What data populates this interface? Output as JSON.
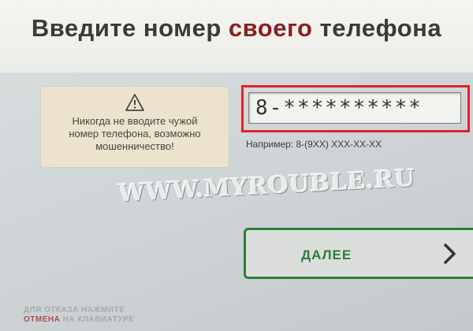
{
  "header": {
    "title_part1": "Введите номер",
    "title_accent": "своего",
    "title_part2": "телефона"
  },
  "warning": {
    "icon": "warning-triangle-icon",
    "text": "Никогда не вводите чужой номер телефона, возможно мошенничество!"
  },
  "phone_field": {
    "value": "8-**********"
  },
  "hint": {
    "text": "Например: 8-(9XX) XXX-XX-XX"
  },
  "watermark": {
    "text": "WWW.MYROUBLE.RU"
  },
  "next_button": {
    "label": "ДАЛЕЕ",
    "icon": "chevron-right-icon"
  },
  "cancel_hint": {
    "line1": "ДЛЯ ОТКАЗА НАЖМИТЕ",
    "cancel_word": "ОТМЕНА",
    "line2_rest": "НА КЛАВИАТУРЕ"
  },
  "colors": {
    "accent_red": "#8a1f1f",
    "highlight_red": "#e0222c",
    "button_green": "#2d7d3a",
    "warning_bg": "#ece3cf"
  }
}
